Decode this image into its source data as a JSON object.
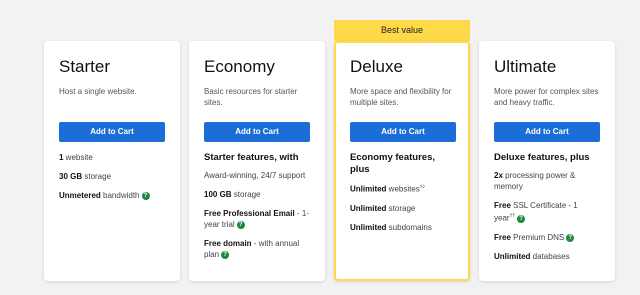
{
  "banner": {
    "text": "Best value"
  },
  "colors": {
    "button": "#1b6ed7",
    "banner": "#fed94a",
    "help_icon": "#1b8a3a"
  },
  "plans": [
    {
      "name": "Starter",
      "desc": "Host a single website.",
      "button": "Add to Cart",
      "features": [
        {
          "bold": "1",
          "text": " website"
        },
        {
          "bold": "30 GB",
          "text": " storage"
        },
        {
          "bold": "Unmetered",
          "text": " bandwidth"
        }
      ]
    },
    {
      "name": "Economy",
      "desc": "Basic resources for starter sites.",
      "button": "Add to Cart",
      "heading": "Starter features, with",
      "features": [
        {
          "bold": "",
          "text": "Award-winning, 24/7 support"
        },
        {
          "bold": "100 GB",
          "text": " storage"
        },
        {
          "bold": "Free Professional Email",
          "text": " - 1-year trial"
        },
        {
          "bold": "Free domain",
          "text": " - with annual plan"
        }
      ]
    },
    {
      "name": "Deluxe",
      "desc": "More space and flexibility for multiple sites.",
      "button": "Add to Cart",
      "heading": "Economy features, plus",
      "features": [
        {
          "bold": "Unlimited",
          "text": " websites",
          "mark": "◊◊"
        },
        {
          "bold": "Unlimited",
          "text": " storage"
        },
        {
          "bold": "Unlimited",
          "text": " subdomains"
        }
      ]
    },
    {
      "name": "Ultimate",
      "desc": "More power for complex sites and heavy traffic.",
      "button": "Add to Cart",
      "heading": "Deluxe features, plus",
      "features": [
        {
          "bold": "2x",
          "text": " processing power & memory"
        },
        {
          "bold": "Free",
          "text": " SSL Certificate - 1 year",
          "mark": "††"
        },
        {
          "bold": "Free",
          "text": " Premium DNS"
        },
        {
          "bold": "Unlimited",
          "text": " databases"
        }
      ]
    }
  ],
  "help_glyph": "?"
}
